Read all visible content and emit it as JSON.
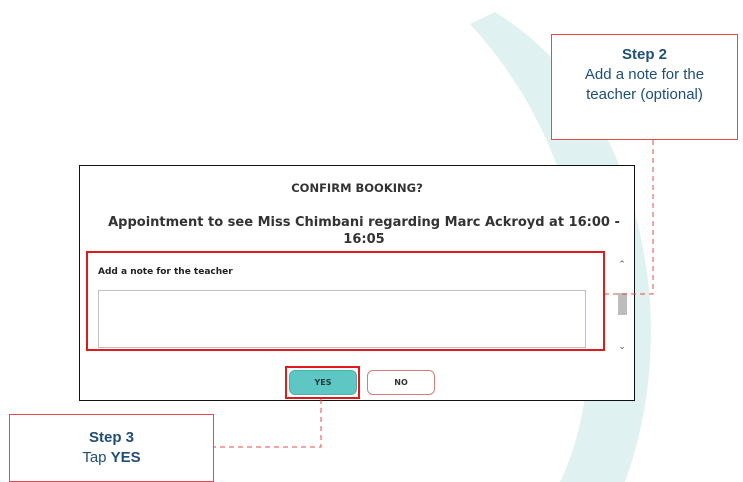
{
  "dialog": {
    "title": "CONFIRM BOOKING?",
    "message": "Appointment to see Miss Chimbani regarding Marc Ackroyd at 16:00 - 16:05",
    "note_label": "Add a note for the teacher",
    "note_value": "",
    "yes_label": "YES",
    "no_label": "NO"
  },
  "callouts": {
    "step2": {
      "heading": "Step 2",
      "text": "Add a note for the teacher (optional)"
    },
    "step3": {
      "heading": "Step 3",
      "prefix": "Tap",
      "emphasis": "YES"
    }
  },
  "colors": {
    "highlight": "#e01b1b",
    "yes_button": "#5ec7c4",
    "callout_text": "#1f4e79",
    "background_arc": "#dff2f1"
  }
}
